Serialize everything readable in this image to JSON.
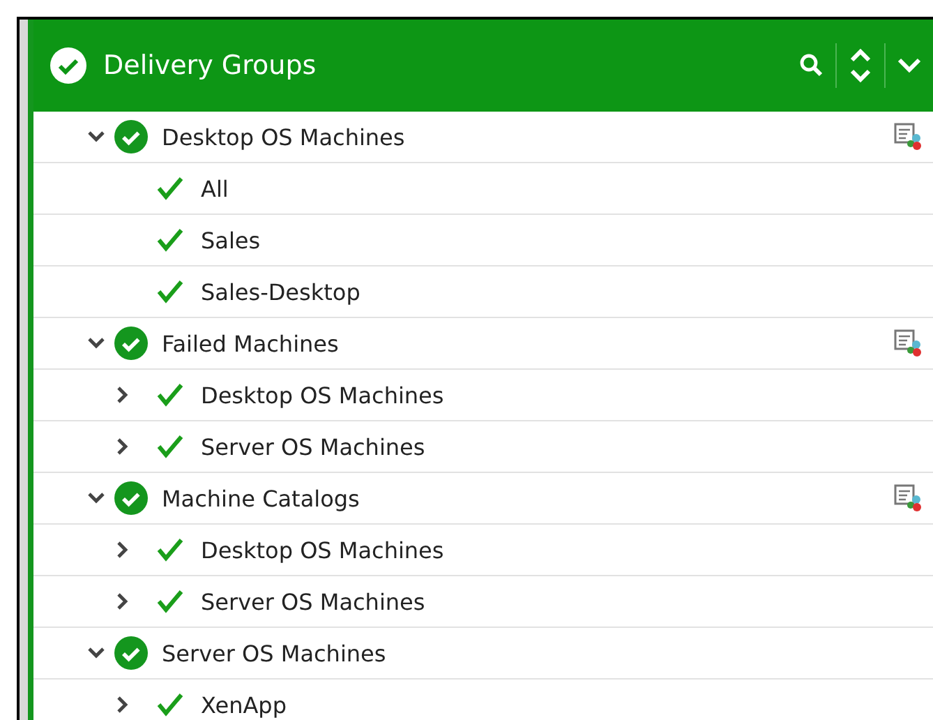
{
  "panel": {
    "title": "Delivery Groups"
  },
  "groups": [
    {
      "label": "Desktop OS Machines",
      "expanded": true,
      "actions": true,
      "children": [
        {
          "label": "All"
        },
        {
          "label": "Sales"
        },
        {
          "label": "Sales-Desktop"
        }
      ]
    },
    {
      "label": "Failed Machines",
      "expanded": true,
      "actions": true,
      "children": [
        {
          "label": "Desktop OS Machines",
          "expanded": false
        },
        {
          "label": "Server OS Machines",
          "expanded": false
        }
      ]
    },
    {
      "label": "Machine Catalogs",
      "expanded": true,
      "actions": true,
      "children": [
        {
          "label": "Desktop OS Machines",
          "expanded": false
        },
        {
          "label": "Server OS Machines",
          "expanded": false
        }
      ]
    },
    {
      "label": "Server OS Machines",
      "expanded": true,
      "actions": false,
      "children": [
        {
          "label": "XenApp",
          "expanded": false
        }
      ]
    }
  ]
}
